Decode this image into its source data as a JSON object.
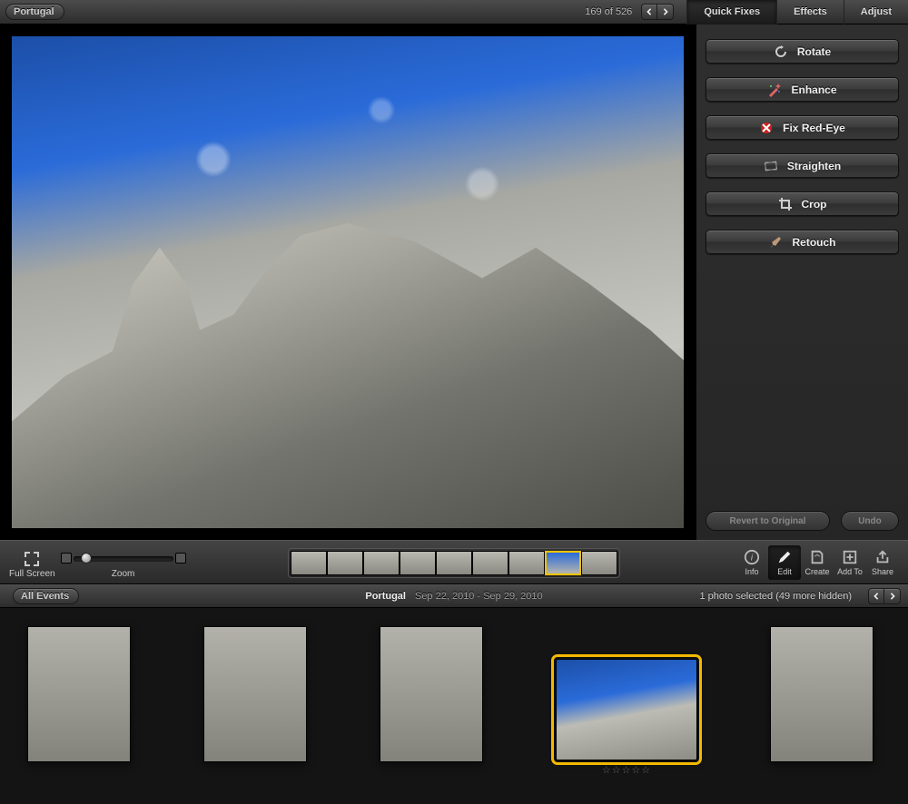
{
  "header": {
    "back_label": "Portugal",
    "counter": "169 of 526",
    "tabs": [
      "Quick Fixes",
      "Effects",
      "Adjust"
    ],
    "active_tab": 0
  },
  "quick_fixes": {
    "rotate": "Rotate",
    "enhance": "Enhance",
    "redeye": "Fix Red-Eye",
    "straighten": "Straighten",
    "crop": "Crop",
    "retouch": "Retouch",
    "revert": "Revert to Original",
    "undo": "Undo"
  },
  "lowerbar": {
    "fullscreen": "Full Screen",
    "zoom": "Zoom",
    "modes": {
      "info": "Info",
      "edit": "Edit",
      "create": "Create",
      "addto": "Add To",
      "share": "Share"
    }
  },
  "events": {
    "back_label": "All Events",
    "title": "Portugal",
    "date_range": "Sep 22, 2010 - Sep 29, 2010",
    "selection": "1 photo selected (49 more hidden)",
    "rating_empty": "☆☆☆☆☆"
  }
}
